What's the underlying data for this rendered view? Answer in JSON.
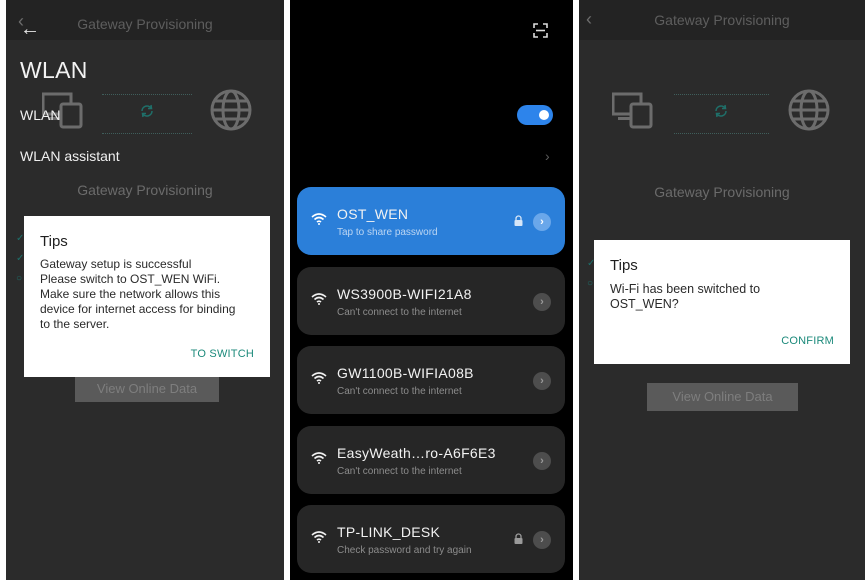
{
  "left_screen": {
    "header_title": "Gateway Provisioning",
    "subtitle": "Gateway Provisioning",
    "view_online_label": "View Online Data",
    "dialog": {
      "title": "Tips",
      "message": "Gateway setup is successful Please switch to OST_WEN WiFi. Make sure the network allows this device for internet access for binding to the server.",
      "lines": [
        "Gateway setup is successful",
        "Please switch to OST_WEN WiFi.",
        "Make sure the network allows this",
        "device for internet access for binding",
        "to the server."
      ],
      "button_label": "TO SWITCH"
    }
  },
  "wlan_screen": {
    "title": "WLAN",
    "wlan_label": "WLAN",
    "wlan_enabled": true,
    "assistant_label": "WLAN assistant",
    "networks": [
      {
        "name": "OST_WEN",
        "status": "Tap to share password",
        "locked": true,
        "active": true
      },
      {
        "name": "WS3900B-WIFI21A8",
        "status": "Can't connect to the internet",
        "locked": false,
        "active": false
      },
      {
        "name": "GW1100B-WIFIA08B",
        "status": "Can't connect to the internet",
        "locked": false,
        "active": false
      },
      {
        "name": "EasyWeath…ro-A6F6E3",
        "status": "Can't connect to the internet",
        "locked": false,
        "active": false
      },
      {
        "name": "TP-LINK_DESK",
        "status": "Check password and try again",
        "locked": true,
        "active": false
      }
    ],
    "colors": {
      "accent": "#2d84eb",
      "active_card": "#2b7fd9"
    }
  },
  "right_screen": {
    "header_title": "Gateway Provisioning",
    "subtitle": "Gateway Provisioning",
    "view_online_label": "View Online Data",
    "dialog": {
      "title": "Tips",
      "lines": [
        "Wi-Fi has been switched to",
        "OST_WEN?"
      ],
      "button_label": "CONFIRM"
    }
  }
}
